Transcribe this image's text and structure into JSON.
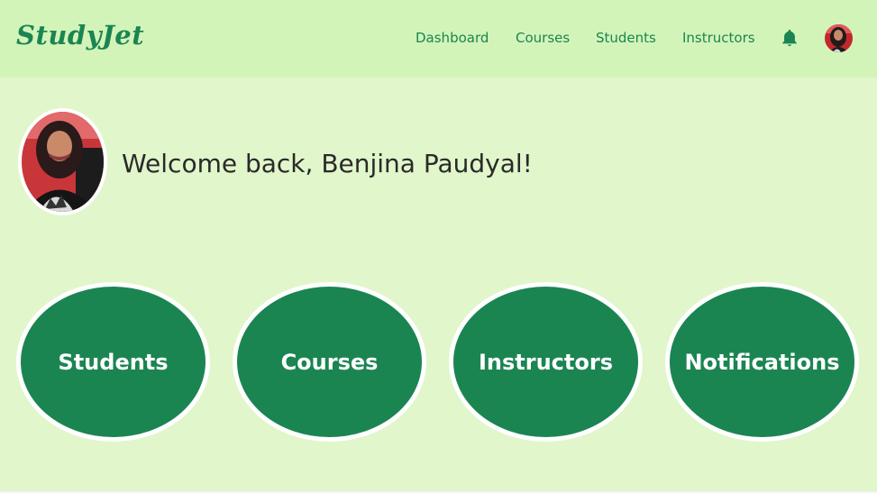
{
  "nav": {
    "brand": "StudyJet",
    "links": [
      "Dashboard",
      "Courses",
      "Students",
      "Instructors"
    ]
  },
  "welcome": {
    "text": "Welcome back, Benjina Paudyal!"
  },
  "tiles": [
    "Students",
    "Courses",
    "Instructors",
    "Notifications"
  ],
  "colors": {
    "accent": "#1b8552",
    "page_bg": "#e1f6cb",
    "nav_bg": "#d3f4b9"
  },
  "icons": {
    "notifications": "bell-icon"
  }
}
